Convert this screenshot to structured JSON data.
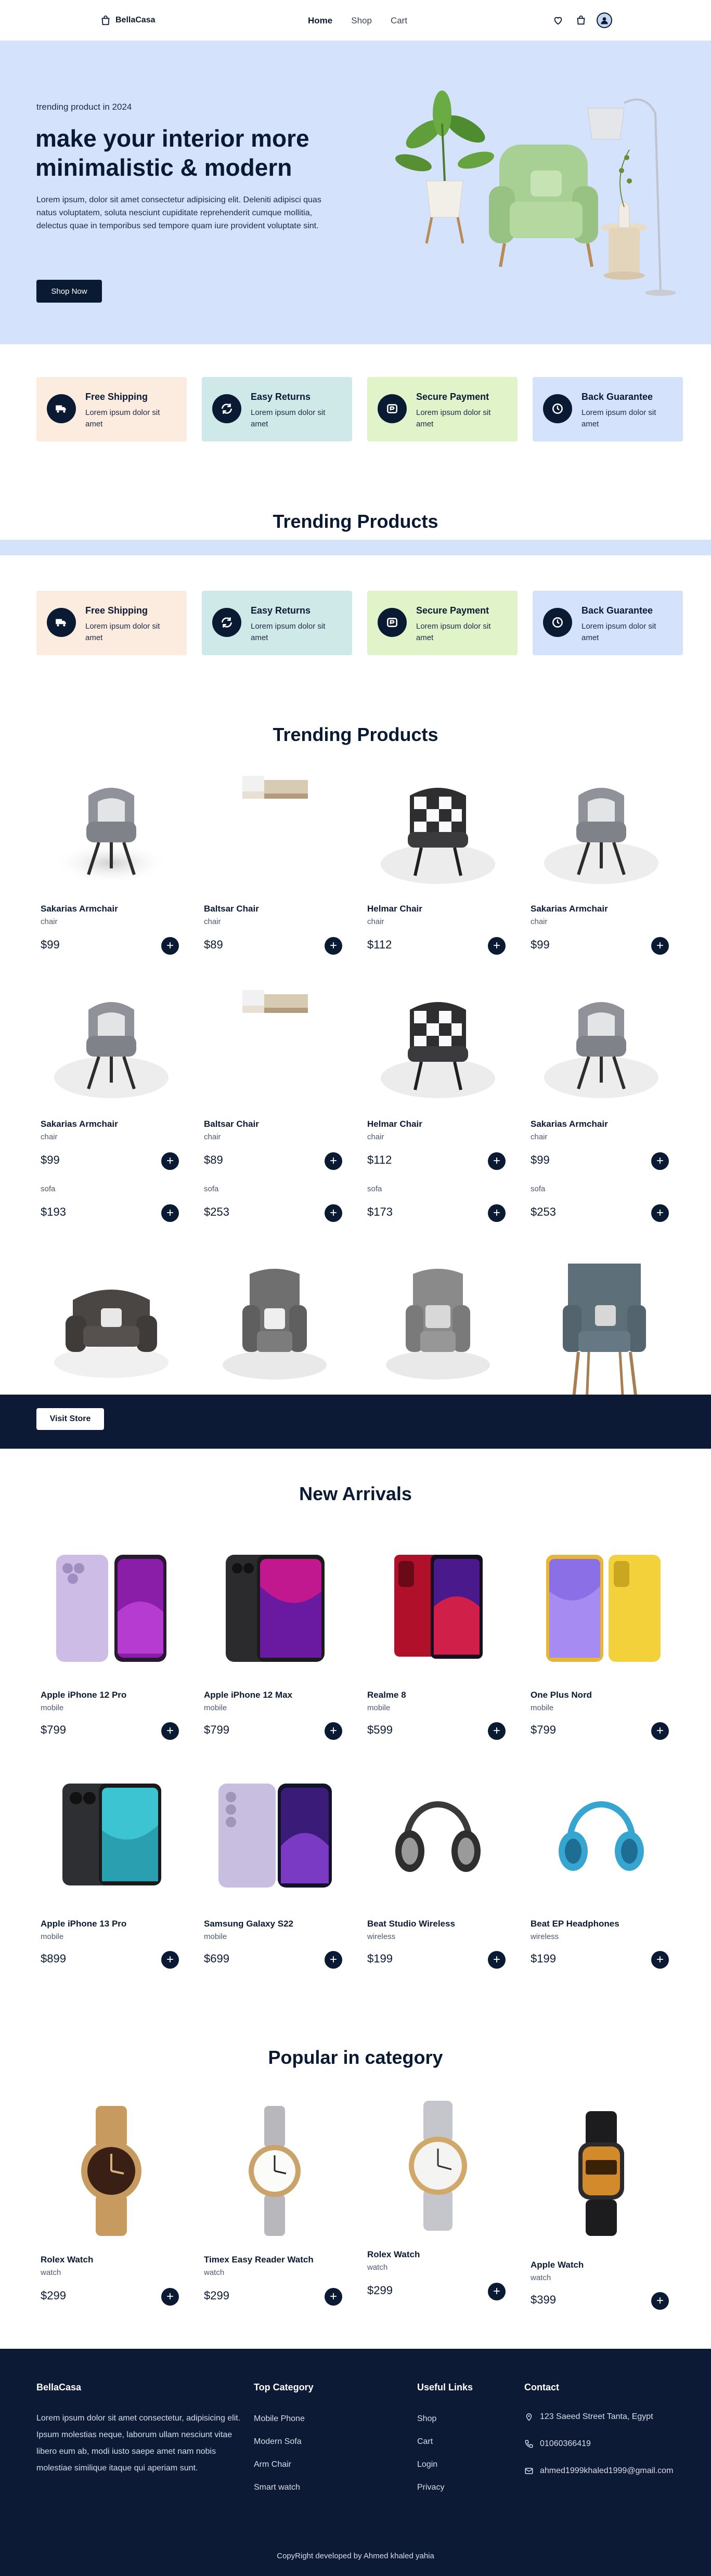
{
  "navbar": {
    "brand": "BellaCasa",
    "links": [
      "Home",
      "Shop",
      "Cart"
    ],
    "active": "Home"
  },
  "hero": {
    "subtitle": "trending product in 2024",
    "title": "make your interior more minimalistic & modern",
    "text": "Lorem ipsum, dolor sit amet consectetur adipisicing elit. Deleniti adipisci quas natus voluptatem, soluta nesciunt cupiditate reprehenderit cumque mollitia, delectus quae in temporibus sed tempore quam iure provident voluptate sint.",
    "button": "Shop Now"
  },
  "services": [
    {
      "title": "Free Shipping",
      "desc": "Lorem ipsum dolor sit amet",
      "bg": "#fcebdf",
      "icon": "truck-icon"
    },
    {
      "title": "Easy Returns",
      "desc": "Lorem ipsum dolor sit amet",
      "bg": "#cfe9e9",
      "icon": "refresh-icon"
    },
    {
      "title": "Secure Payment",
      "desc": "Lorem ipsum dolor sit amet",
      "bg": "#e0f3c9",
      "icon": "payment-icon"
    },
    {
      "title": "Back Guarantee",
      "desc": "Lorem ipsum dolor sit amet",
      "bg": "#d5e2fb",
      "icon": "guarantee-icon"
    }
  ],
  "sections": {
    "trending_1": "Trending Products",
    "trending_2": "Trending Products",
    "new_arrivals": "New Arrivals",
    "popular": "Popular in category"
  },
  "trending_row1": [
    {
      "name": "Sakarias Armchair",
      "category": "chair",
      "price": "$99",
      "image": "armchair-grey"
    },
    {
      "name": "Baltsar Chair",
      "category": "chair",
      "price": "$89",
      "image": "chair-beige-cropped"
    },
    {
      "name": "Helmar Chair",
      "category": "chair",
      "price": "$112",
      "image": "armchair-checkered"
    },
    {
      "name": "Sakarias Armchair",
      "category": "chair",
      "price": "$99",
      "image": "armchair-grey"
    }
  ],
  "trending_row2": [
    {
      "name": "Sakarias Armchair",
      "category": "chair",
      "price": "$99",
      "image": "armchair-grey"
    },
    {
      "name": "Baltsar Chair",
      "category": "chair",
      "price": "$89",
      "image": "chair-beige-cropped"
    },
    {
      "name": "Helmar Chair",
      "category": "chair",
      "price": "$112",
      "image": "armchair-checkered"
    },
    {
      "name": "Sakarias Armchair",
      "category": "chair",
      "price": "$99",
      "image": "armchair-grey"
    }
  ],
  "sofa_row": [
    {
      "category": "sofa",
      "price": "$193"
    },
    {
      "category": "sofa",
      "price": "$253"
    },
    {
      "category": "sofa",
      "price": "$173"
    },
    {
      "category": "sofa",
      "price": "$253"
    }
  ],
  "visit_store": "Visit Store",
  "new_arrivals_row1": [
    {
      "name": "Apple iPhone 12 Pro",
      "category": "mobile",
      "price": "$799",
      "colors": [
        "#cdbde6",
        "#8a1ea8"
      ]
    },
    {
      "name": "Apple iPhone 12 Max",
      "category": "mobile",
      "price": "$799",
      "colors": [
        "#2b2b2e",
        "#c2188f"
      ]
    },
    {
      "name": "Realme 8",
      "category": "mobile",
      "price": "$599",
      "colors": [
        "#b0102a",
        "#4a1a8c"
      ]
    },
    {
      "name": "One Plus Nord",
      "category": "mobile",
      "price": "$799",
      "colors": [
        "#8b6fe6",
        "#f2d13a"
      ]
    }
  ],
  "new_arrivals_row2": [
    {
      "name": "Apple iPhone 13 Pro",
      "category": "mobile",
      "price": "$899",
      "colors": [
        "#2e2f33",
        "#3cc4d2"
      ]
    },
    {
      "name": "Samsung Galaxy S22",
      "category": "mobile",
      "price": "$699",
      "colors": [
        "#c8bfe0",
        "#3a1c78"
      ]
    },
    {
      "name": "Beat Studio Wireless",
      "category": "wireless",
      "price": "$199",
      "colors": [
        "#3a3a3a",
        "#9a9a9a"
      ]
    },
    {
      "name": "Beat EP Headphones",
      "category": "wireless",
      "price": "$199",
      "colors": [
        "#36a6d0",
        "#1e6d93"
      ]
    }
  ],
  "popular_row": [
    {
      "name": "Rolex Watch",
      "category": "watch",
      "price": "$299"
    },
    {
      "name": "Timex Easy Reader Watch",
      "category": "watch",
      "price": "$299"
    },
    {
      "name": "Rolex Watch",
      "category": "watch",
      "price": "$299"
    },
    {
      "name": "Apple Watch",
      "category": "watch",
      "price": "$399"
    }
  ],
  "footer": {
    "brand": "BellaCasa",
    "about": "Lorem ipsum dolor sit amet consectetur, adipisicing elit. Ipsum molestias neque, laborum ullam nesciunt vitae libero eum ab, modi iusto saepe amet nam nobis molestiae similique itaque qui aperiam sunt.",
    "top_category_title": "Top Category",
    "top_category": [
      "Mobile Phone",
      "Modern Sofa",
      "Arm Chair",
      "Smart watch"
    ],
    "useful_links_title": "Useful Links",
    "useful_links": [
      "Shop",
      "Cart",
      "Login",
      "Privacy"
    ],
    "contact_title": "Contact",
    "address": "123 Saeed Street Tanta, Egypt",
    "phone": "01060366419",
    "email": "ahmed1999khaled1999@gmail.com",
    "copyright": "CopyRight developed by Ahmed khaled yahia"
  }
}
